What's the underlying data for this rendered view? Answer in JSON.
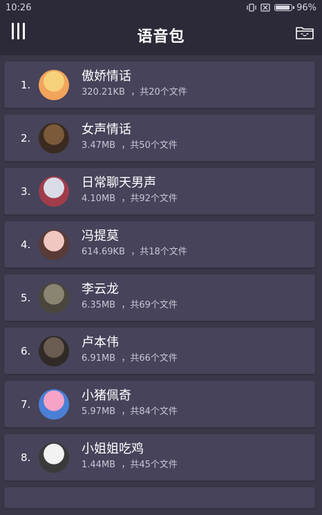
{
  "status": {
    "time": "10:26",
    "battery": "96%"
  },
  "header": {
    "title": "语音包"
  },
  "items": [
    {
      "index": "1.",
      "name": "傲娇情话",
      "size": "320.21KB",
      "files": "，共20个文件",
      "avatar_colors": [
        "#f5d27a",
        "#f2a45a"
      ]
    },
    {
      "index": "2.",
      "name": "女声情话",
      "size": "3.47MB",
      "files": "，共50个文件",
      "avatar_colors": [
        "#7a5a3a",
        "#3b2a20"
      ]
    },
    {
      "index": "3.",
      "name": "日常聊天男声",
      "size": "4.10MB",
      "files": "，共92个文件",
      "avatar_colors": [
        "#d9dce6",
        "#a13c4a"
      ]
    },
    {
      "index": "4.",
      "name": "冯提莫",
      "size": "614.69KB",
      "files": "，共18个文件",
      "avatar_colors": [
        "#f1c7c2",
        "#5a3a36"
      ]
    },
    {
      "index": "5.",
      "name": "李云龙",
      "size": "6.35MB",
      "files": "，共69个文件",
      "avatar_colors": [
        "#8a8472",
        "#4a463c"
      ]
    },
    {
      "index": "6.",
      "name": "卢本伟",
      "size": "6.91MB",
      "files": "，共66个文件",
      "avatar_colors": [
        "#6a5c50",
        "#2f2a26"
      ]
    },
    {
      "index": "7.",
      "name": "小猪佩奇",
      "size": "5.97MB",
      "files": "，共84个文件",
      "avatar_colors": [
        "#f5a3c7",
        "#4a7fd6"
      ]
    },
    {
      "index": "8.",
      "name": "小姐姐吃鸡",
      "size": "1.44MB",
      "files": "，共45个文件",
      "avatar_colors": [
        "#f2f2f2",
        "#3a3a3a"
      ]
    }
  ]
}
